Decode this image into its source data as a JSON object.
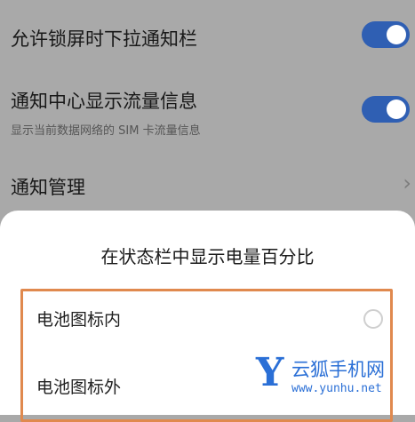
{
  "settings": {
    "rows": [
      {
        "title": "允许锁屏时下拉通知栏",
        "toggle": "on"
      },
      {
        "title": "通知中心显示流量信息",
        "subtitle": "显示当前数据网络的 SIM 卡流量信息",
        "toggle": "on"
      },
      {
        "title": "通知管理",
        "icon": "chevron-right-icon"
      }
    ]
  },
  "dialog": {
    "title": "在状态栏中显示电量百分比",
    "options": [
      {
        "label": "电池图标内",
        "selected": false
      },
      {
        "label": "电池图标外",
        "selected": false
      }
    ]
  },
  "watermark": {
    "logo_letter": "Y",
    "name": "云狐手机网",
    "url": "www.yunhu.net"
  },
  "colors": {
    "toggle_on": "#2f5fb3",
    "highlight_border": "#e0894e",
    "watermark": "#2a6fd6"
  }
}
